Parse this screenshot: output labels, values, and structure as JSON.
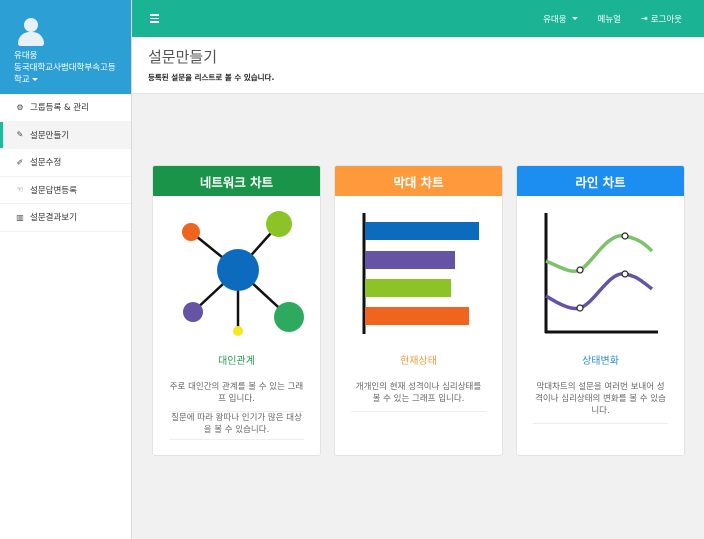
{
  "user": {
    "name": "유대웅",
    "org_line1": "동국대학교사범대학부속고등",
    "org_line2": "학교"
  },
  "topbar": {
    "user": "유대웅",
    "menu_list": "메뉴얼",
    "logout": "로그아웃"
  },
  "header": {
    "title": "설문만들기",
    "subtitle": "등록된 설문을 리스트로 볼 수 있습니다."
  },
  "sidebar": {
    "items": [
      {
        "label": "그룹등록 & 관리",
        "icon": "gears-icon"
      },
      {
        "label": "설문만들기",
        "icon": "magic-icon"
      },
      {
        "label": "설문수정",
        "icon": "edit-icon"
      },
      {
        "label": "설문답변등록",
        "icon": "hand-icon"
      },
      {
        "label": "설문결과보기",
        "icon": "bar-chart-icon"
      }
    ]
  },
  "cards": [
    {
      "title": "네트워크 차트",
      "subtitle": "대인관계",
      "desc": "주로 대인간의 관계를 볼 수 있는 그래프 입니다.",
      "desc2": "질문에 따라 왕따나 인기가 많은 대상을 볼 수 있습니다.",
      "color": "#1a9448",
      "subcolor": "#2a9a4e"
    },
    {
      "title": "막대 차트",
      "subtitle": "현재상태",
      "desc": "개개인의 현재 성격이나 심리상태를 볼 수 있는 그래프 입니다.",
      "color": "#ff9a3c",
      "subcolor": "#f39a3a"
    },
    {
      "title": "라인 차트",
      "subtitle": "상태변화",
      "desc": "막대차트의 설문을 여러번 보내어 성격이나 심리상태의 변화를 볼 수 있습니다.",
      "color": "#1c8ef2",
      "subcolor": "#2b8ed8"
    }
  ],
  "colors": {
    "topbar": "#1ab394",
    "profile": "#2c9fd4",
    "active_marker": "#1abc9c"
  }
}
